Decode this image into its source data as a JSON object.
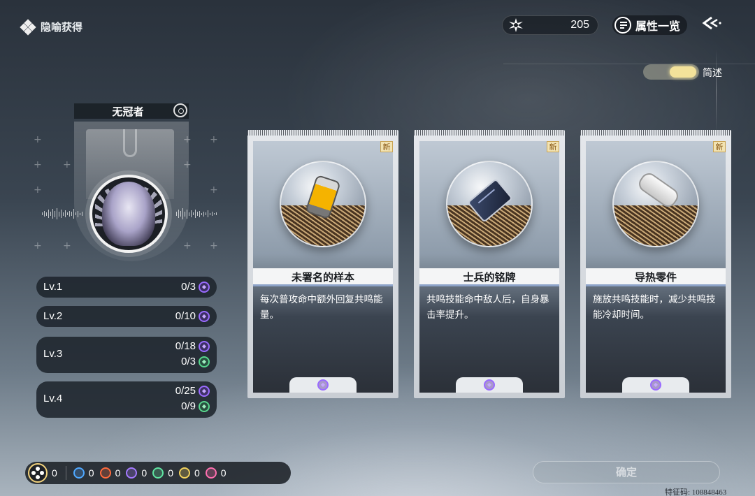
{
  "header": {
    "title": "隐喻获得",
    "currency_value": "205",
    "attributes_button": "属性一览"
  },
  "toggle": {
    "label": "简述",
    "state": "on"
  },
  "character": {
    "name": "无冠者"
  },
  "levels": [
    {
      "label": "Lv.1",
      "rows": [
        {
          "value": "0/3",
          "icon": "purple"
        }
      ]
    },
    {
      "label": "Lv.2",
      "rows": [
        {
          "value": "0/10",
          "icon": "purple"
        }
      ]
    },
    {
      "label": "Lv.3",
      "rows": [
        {
          "value": "0/18",
          "icon": "purple"
        },
        {
          "value": "0/3",
          "icon": "green"
        }
      ]
    },
    {
      "label": "Lv.4",
      "rows": [
        {
          "value": "0/25",
          "icon": "purple"
        },
        {
          "value": "0/9",
          "icon": "green"
        }
      ]
    }
  ],
  "cards": [
    {
      "badge": "新",
      "name": "未署名的样本",
      "description": "每次普攻命中额外回复共鸣能量。",
      "item_icon": "capsule-sample-icon"
    },
    {
      "badge": "新",
      "name": "士兵的铭牌",
      "description": "共鸣技能命中敌人后，自身暴击率提升。",
      "item_icon": "dog-tag-icon"
    },
    {
      "badge": "新",
      "name": "导热零件",
      "description": "施放共鸣技能时，减少共鸣技能冷却时间。",
      "item_icon": "thermal-part-icon"
    }
  ],
  "bottom_bar": {
    "all_count": "0",
    "elements": [
      {
        "name": "glacio",
        "count": "0",
        "color": "#4fa8ff"
      },
      {
        "name": "fusion",
        "count": "0",
        "color": "#ff6a3c"
      },
      {
        "name": "havoc",
        "count": "0",
        "color": "#a57aff"
      },
      {
        "name": "aero",
        "count": "0",
        "color": "#5fe3a1"
      },
      {
        "name": "electro",
        "count": "0",
        "color": "#f2d25c"
      },
      {
        "name": "spectro",
        "count": "0",
        "color": "#ff6fb0"
      }
    ]
  },
  "confirm_button": "确定",
  "feature_code": "特征码: 108848463",
  "colors": {
    "accent_gold": "#f3e29a",
    "card_frame": "#e5e8ec",
    "havoc_purple": "#9a6bff",
    "aero_green": "#58d68d"
  }
}
